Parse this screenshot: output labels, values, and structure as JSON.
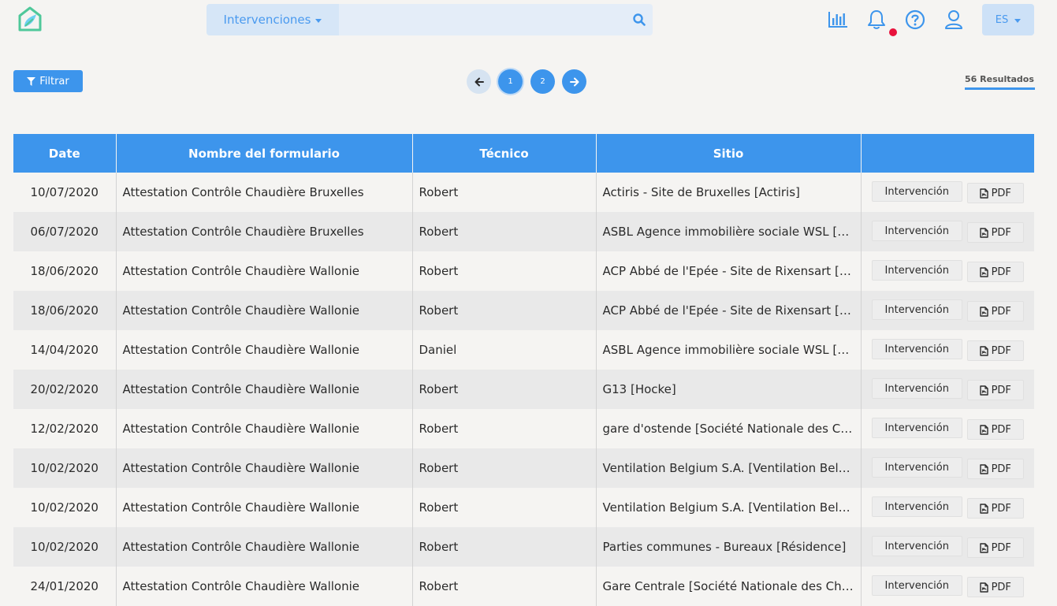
{
  "header": {
    "search_type": "Intervenciones",
    "search_placeholder": "",
    "language": "ES",
    "accent_color": "#3d95ec",
    "notification_dot_color": "#e8123c"
  },
  "toolbar": {
    "filter_label": "Filtrar",
    "pages": [
      "1",
      "2"
    ],
    "current_page": "1",
    "results_label": "56 Resultados"
  },
  "table": {
    "columns": [
      "Date",
      "Nombre del formulario",
      "Técnico",
      "Sitio",
      ""
    ],
    "action_labels": {
      "intervention": "Intervención",
      "pdf": "PDF"
    },
    "rows": [
      {
        "date": "10/07/2020",
        "form": "Attestation Contrôle Chaudière Bruxelles",
        "tech": "Robert",
        "site": "Actiris - Site de Bruxelles [Actiris]"
      },
      {
        "date": "06/07/2020",
        "form": "Attestation Contrôle Chaudière Bruxelles",
        "tech": "Robert",
        "site": "ASBL Agence immobilière sociale WSL [ASBL Agence immobilière sociale WSL]"
      },
      {
        "date": "18/06/2020",
        "form": "Attestation Contrôle Chaudière Wallonie",
        "tech": "Robert",
        "site": "ACP Abbé de l'Epée - Site de Rixensart [ACP Abbé de l'Epée]"
      },
      {
        "date": "18/06/2020",
        "form": "Attestation Contrôle Chaudière Wallonie",
        "tech": "Robert",
        "site": "ACP Abbé de l'Epée - Site de Rixensart [ACP Abbé de l'Epée]"
      },
      {
        "date": "14/04/2020",
        "form": "Attestation Contrôle Chaudière Wallonie",
        "tech": "Daniel",
        "site": "ASBL Agence immobilière sociale WSL [ASBL Agence immobilière sociale WSL]"
      },
      {
        "date": "20/02/2020",
        "form": "Attestation Contrôle Chaudière Wallonie",
        "tech": "Robert",
        "site": "G13 [Hocke]"
      },
      {
        "date": "12/02/2020",
        "form": "Attestation Contrôle Chaudière Wallonie",
        "tech": "Robert",
        "site": "gare d'ostende [Société Nationale des Chemins de fer]"
      },
      {
        "date": "10/02/2020",
        "form": "Attestation Contrôle Chaudière Wallonie",
        "tech": "Robert",
        "site": "Ventilation Belgium S.A. [Ventilation Belgium S.A.]"
      },
      {
        "date": "10/02/2020",
        "form": "Attestation Contrôle Chaudière Wallonie",
        "tech": "Robert",
        "site": "Ventilation Belgium S.A. [Ventilation Belgium S.A.]"
      },
      {
        "date": "10/02/2020",
        "form": "Attestation Contrôle Chaudière Wallonie",
        "tech": "Robert",
        "site": "Parties communes - Bureaux [Résidence]"
      },
      {
        "date": "24/01/2020",
        "form": "Attestation Contrôle Chaudière Wallonie",
        "tech": "Robert",
        "site": "Gare Centrale [Société Nationale des Chemins de fer]"
      }
    ]
  }
}
